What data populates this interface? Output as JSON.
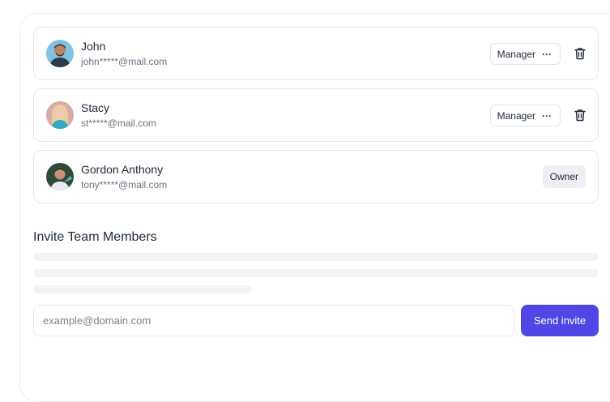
{
  "members": [
    {
      "name": "John",
      "email": "john*****@mail.com",
      "role": "Manager",
      "avatar_icon": "avatar-icon"
    },
    {
      "name": "Stacy",
      "email": "st*****@mail.com",
      "role": "Manager",
      "avatar_icon": "avatar-icon"
    },
    {
      "name": "Gordon Anthony",
      "email": "tony*****@mail.com",
      "role": "Owner",
      "avatar_icon": "avatar-icon"
    }
  ],
  "invite": {
    "title": "Invite Team Members",
    "placeholder": "example@domain.com",
    "value": "",
    "send_label": "Send invite"
  },
  "icons": {
    "more": "more-horizontal-icon",
    "delete": "trash-icon"
  },
  "colors": {
    "accent": "#4f46e5",
    "owner_badge_bg": "#eeeef4",
    "skeleton": "#f2f3f5"
  }
}
